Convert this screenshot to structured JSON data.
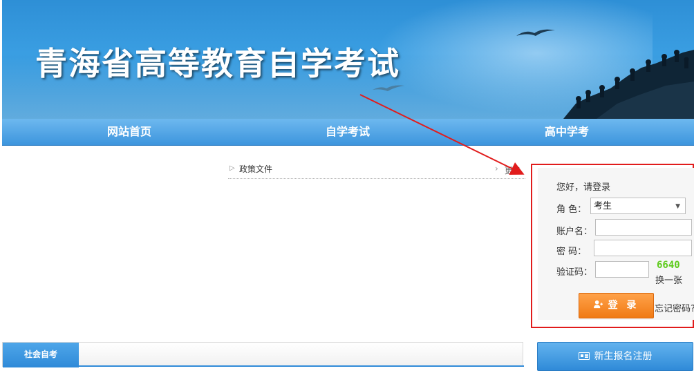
{
  "banner": {
    "title": "青海省高等教育自学考试"
  },
  "nav": {
    "items": [
      {
        "label": "网站首页"
      },
      {
        "label": "自学考试"
      },
      {
        "label": "高中学考"
      }
    ]
  },
  "news": {
    "label": "政策文件",
    "more": "更多"
  },
  "login": {
    "greeting": "您好，请登录",
    "role_label": "角 色：",
    "role_value": "考生",
    "account_label": "账户名：",
    "password_label": "密 码：",
    "captcha_label": "验证码：",
    "captcha_code": "6640",
    "refresh_label": "换一张",
    "submit_label": "登 录",
    "forgot_label": "忘记密码?"
  },
  "section": {
    "tab_label": "社会自考"
  },
  "register": {
    "label": "新生报名注册"
  },
  "colors": {
    "nav_blue": "#3d95dd",
    "login_orange": "#f07a14",
    "highlight_red": "#e11c1c",
    "captcha_green": "#5ecb1c"
  }
}
